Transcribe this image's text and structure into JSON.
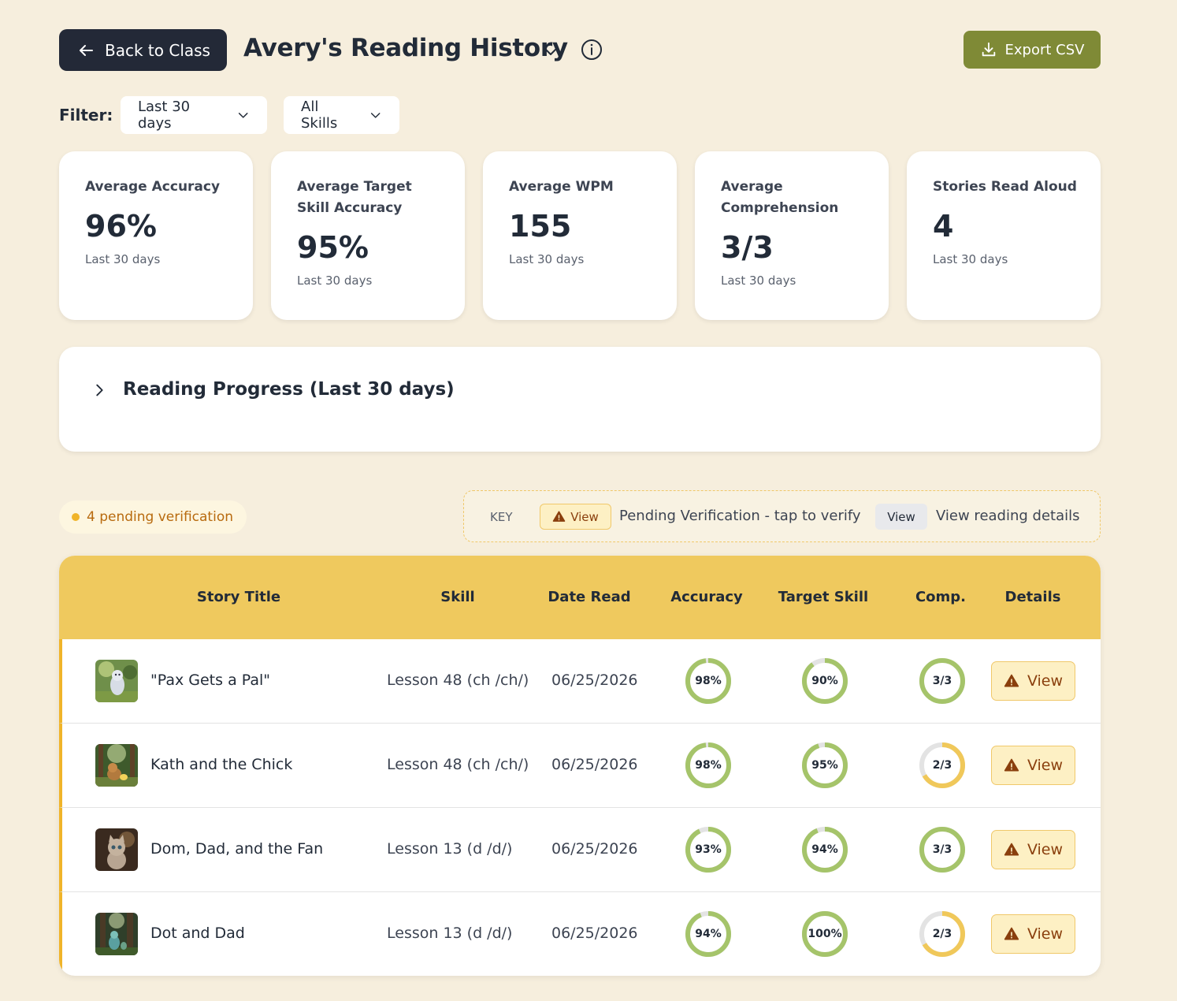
{
  "header": {
    "back_label": "Back to Class",
    "title": "Avery's Reading History",
    "export_label": "Export CSV"
  },
  "filters": {
    "label": "Filter:",
    "range_value": "Last 30 days",
    "skills_value": "All Skills"
  },
  "stats": [
    {
      "label": "Average Accuracy",
      "value": "96%",
      "sub": "Last 30 days"
    },
    {
      "label": "Average Target Skill Accuracy",
      "value": "95%",
      "sub": "Last 30 days"
    },
    {
      "label": "Average WPM",
      "value": "155",
      "sub": "Last 30 days"
    },
    {
      "label": "Average Comprehension",
      "value": "3/3",
      "sub": "Last 30 days"
    },
    {
      "label": "Stories Read Aloud",
      "value": "4",
      "sub": "Last 30 days"
    }
  ],
  "progress": {
    "title": "Reading Progress (Last 30 days)"
  },
  "pending": {
    "label": "4 pending verification"
  },
  "key": {
    "label": "KEY",
    "pending_btn": "View",
    "pending_text": "Pending Verification - tap to verify",
    "plain_btn": "View",
    "plain_text": "View reading details"
  },
  "table": {
    "headers": {
      "title": "Story Title",
      "skill": "Skill",
      "date": "Date Read",
      "accuracy": "Accuracy",
      "target": "Target Skill",
      "comp": "Comp.",
      "details": "Details"
    },
    "rows": [
      {
        "title": "\"Pax Gets a Pal\"",
        "skill": "Lesson 48 (ch /ch/)",
        "date": "06/25/2026",
        "accuracy": "98%",
        "accuracy_pct": 98,
        "target": "90%",
        "target_pct": 90,
        "comp": "3/3",
        "comp_frac": 1.0,
        "view": "View"
      },
      {
        "title": "Kath and the Chick",
        "skill": "Lesson 48 (ch /ch/)",
        "date": "06/25/2026",
        "accuracy": "98%",
        "accuracy_pct": 98,
        "target": "95%",
        "target_pct": 95,
        "comp": "2/3",
        "comp_frac": 0.667,
        "view": "View"
      },
      {
        "title": "Dom, Dad, and the Fan",
        "skill": "Lesson 13 (d /d/)",
        "date": "06/25/2026",
        "accuracy": "93%",
        "accuracy_pct": 93,
        "target": "94%",
        "target_pct": 94,
        "comp": "3/3",
        "comp_frac": 1.0,
        "view": "View"
      },
      {
        "title": "Dot and Dad",
        "skill": "Lesson 13 (d /d/)",
        "date": "06/25/2026",
        "accuracy": "94%",
        "accuracy_pct": 94,
        "target": "100%",
        "target_pct": 100,
        "comp": "2/3",
        "comp_frac": 0.667,
        "view": "View"
      }
    ]
  },
  "colors": {
    "background": "#f6eedd",
    "dark_button": "#232937",
    "export_green": "#7f8a36",
    "table_header": "#efc95e",
    "ring_good": "#a5c46a",
    "ring_partial": "#f0c85a",
    "ring_track": "#e3e3e3",
    "pending_orange": "#b86a0e",
    "row_accent": "#f0b429"
  },
  "icons": {
    "back": "arrow-left-icon",
    "title_dropdown": "chevron-down-icon",
    "info": "info-circle-icon",
    "export": "download-icon",
    "progress_toggle": "chevron-right-icon",
    "warning": "warning-triangle-icon"
  }
}
